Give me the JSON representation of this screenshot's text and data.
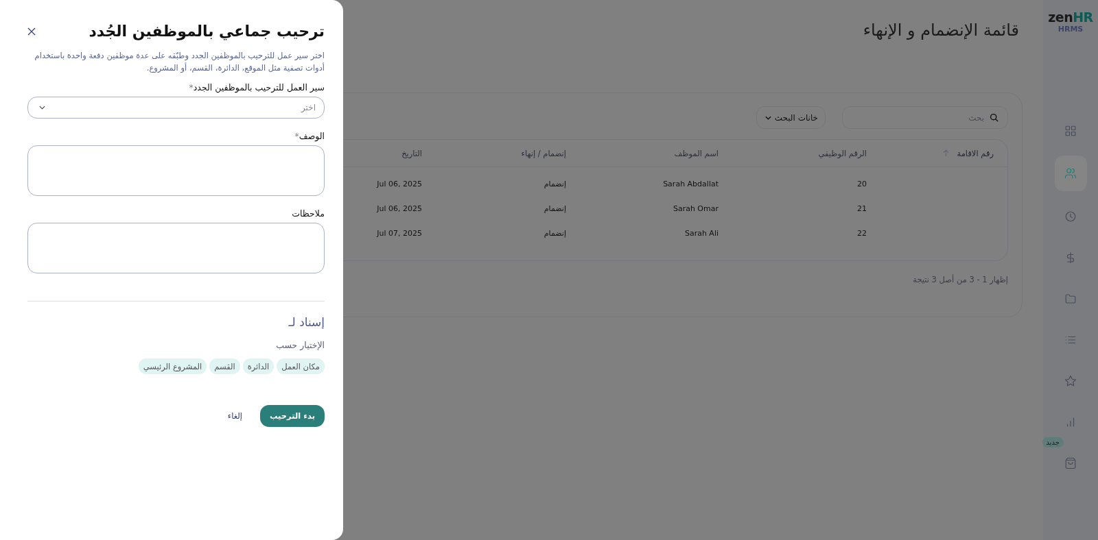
{
  "sidebar": {
    "logo": {
      "word": "zen",
      "accent": "HR"
    },
    "logo_sub": "HRMS",
    "items": [
      {
        "selected": false
      },
      {
        "selected": true
      },
      {
        "selected": false
      },
      {
        "selected": false
      },
      {
        "selected": false
      },
      {
        "selected": false
      },
      {
        "selected": false
      },
      {
        "selected": false
      },
      {
        "selected": false,
        "badge": "جديد"
      }
    ]
  },
  "page": {
    "title": "قائمة الإنضمام و الإنهاء",
    "search": {
      "placeholder": "بحث"
    },
    "filter_button": "خانات البحث",
    "table": {
      "columns": [
        {
          "label": "رقم الاقامة",
          "sorted": true
        },
        {
          "label": "الرقم الوظيفي",
          "sorted": false
        },
        {
          "label": "اسم الموظف",
          "sorted": false
        },
        {
          "label": "إنضمام / إنهاء",
          "sorted": false
        },
        {
          "label": "التاريخ",
          "sorted": false
        }
      ],
      "rows": [
        {
          "employee_no": "20",
          "name": "Sarah Abdallat",
          "type": "إنضمام",
          "date": "Jul 06, 2025"
        },
        {
          "employee_no": "21",
          "name": "Sarah Omar",
          "type": "إنضمام",
          "date": "Jul 06, 2025"
        },
        {
          "employee_no": "22",
          "name": "Sarah Ali",
          "type": "إنضمام",
          "date": "Jul 07, 2025"
        }
      ]
    },
    "pagination_info": "إظهار 1 - 3 من أصل 3 نتيجة"
  },
  "drawer": {
    "title": "ترحيب جماعي بالموظفين الجُدد",
    "description": "اختر سير عمل للترحيب بالموظفين الجدد وطبّقه على عدة موظفين دفعة واحدة باستخدام أدوات تصفية مثل الموقع، الدائرة، القسم، أو المشروع.",
    "fields": [
      {
        "kind": "select",
        "label": "سير العمل للترحيب بالموظفين الجدد",
        "required_mark": "*",
        "placeholder": "اختر"
      },
      {
        "kind": "textarea",
        "label": "الوصف",
        "required_mark": "*"
      },
      {
        "kind": "textarea",
        "label": "ملاحظات"
      }
    ],
    "assign_heading": "إسناد لـ",
    "select_by_label": "الإختيار حسب",
    "chips": [
      "مكان العمل",
      "الدائرة",
      "القسم",
      "المشروع الرئيسي"
    ],
    "primary_button": "بدء الترحيب",
    "cancel_button": "إلغاء"
  }
}
